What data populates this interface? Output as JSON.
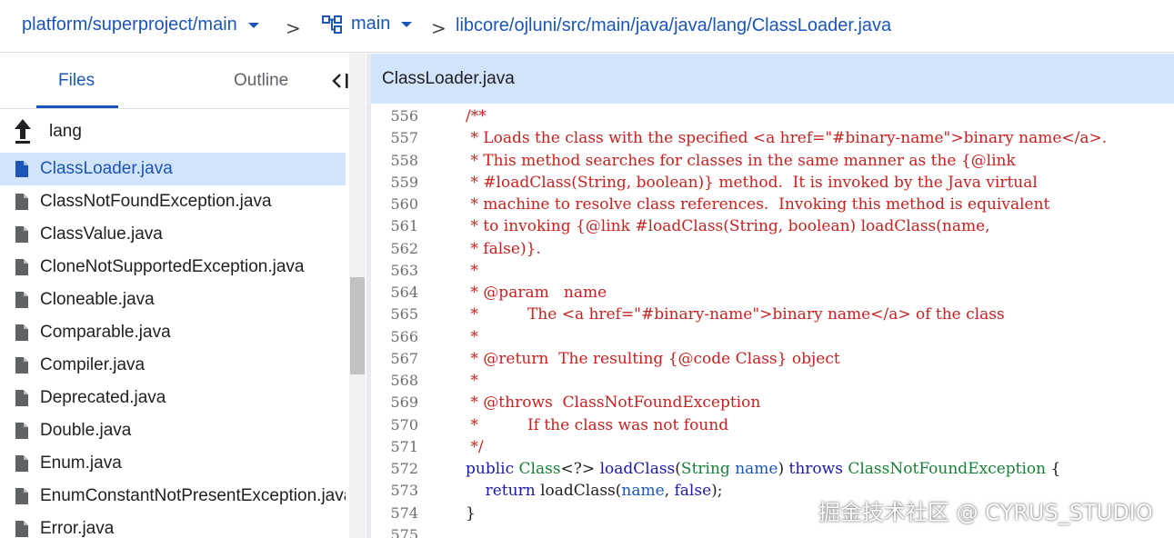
{
  "breadcrumb": {
    "project": "platform/superproject/main",
    "branch": "main",
    "path": "libcore/ojluni/src/main/java/java/lang/ClassLoader.java",
    "separator": ">"
  },
  "sidebar": {
    "tabs": [
      {
        "label": "Files",
        "active": true
      },
      {
        "label": "Outline",
        "active": false
      }
    ],
    "collapse_icon": "collapse-left-icon",
    "parent_dir": {
      "label": "lang",
      "icon": "up-arrow-icon"
    },
    "files": [
      {
        "name": "ClassLoader.java",
        "selected": true
      },
      {
        "name": "ClassNotFoundException.java",
        "selected": false
      },
      {
        "name": "ClassValue.java",
        "selected": false
      },
      {
        "name": "CloneNotSupportedException.java",
        "selected": false
      },
      {
        "name": "Cloneable.java",
        "selected": false
      },
      {
        "name": "Comparable.java",
        "selected": false
      },
      {
        "name": "Compiler.java",
        "selected": false
      },
      {
        "name": "Deprecated.java",
        "selected": false
      },
      {
        "name": "Double.java",
        "selected": false
      },
      {
        "name": "Enum.java",
        "selected": false
      },
      {
        "name": "EnumConstantNotPresentException.java",
        "selected": false
      },
      {
        "name": "Error.java",
        "selected": false
      }
    ]
  },
  "editor": {
    "file_title": "ClassLoader.java",
    "lines": [
      {
        "num": "556",
        "tokens": [
          {
            "t": "/**",
            "k": "comment"
          }
        ]
      },
      {
        "num": "557",
        "tokens": [
          {
            "t": " * Loads the class with the specified <a href=\"#binary-name\">binary name</a>.",
            "k": "comment"
          }
        ]
      },
      {
        "num": "558",
        "tokens": [
          {
            "t": " * This method searches for classes in the same manner as the {@link",
            "k": "comment"
          }
        ]
      },
      {
        "num": "559",
        "tokens": [
          {
            "t": " * #loadClass(String, boolean)} method.  It is invoked by the Java virtual",
            "k": "comment"
          }
        ]
      },
      {
        "num": "560",
        "tokens": [
          {
            "t": " * machine to resolve class references.  Invoking this method is equivalent",
            "k": "comment"
          }
        ]
      },
      {
        "num": "561",
        "tokens": [
          {
            "t": " * to invoking {@link #loadClass(String, boolean) loadClass(name,",
            "k": "comment"
          }
        ]
      },
      {
        "num": "562",
        "tokens": [
          {
            "t": " * false)}.",
            "k": "comment"
          }
        ]
      },
      {
        "num": "563",
        "tokens": [
          {
            "t": " *",
            "k": "comment"
          }
        ]
      },
      {
        "num": "564",
        "tokens": [
          {
            "t": " * @param   name",
            "k": "comment"
          }
        ]
      },
      {
        "num": "565",
        "tokens": [
          {
            "t": " *          The <a href=\"#binary-name\">binary name</a> of the class",
            "k": "comment"
          }
        ]
      },
      {
        "num": "566",
        "tokens": [
          {
            "t": " *",
            "k": "comment"
          }
        ]
      },
      {
        "num": "567",
        "tokens": [
          {
            "t": " * @return  The resulting {@code Class} object",
            "k": "comment"
          }
        ]
      },
      {
        "num": "568",
        "tokens": [
          {
            "t": " *",
            "k": "comment"
          }
        ]
      },
      {
        "num": "569",
        "tokens": [
          {
            "t": " * @throws  ClassNotFoundException",
            "k": "comment"
          }
        ]
      },
      {
        "num": "570",
        "tokens": [
          {
            "t": " *          If the class was not found",
            "k": "comment"
          }
        ]
      },
      {
        "num": "571",
        "tokens": [
          {
            "t": " */",
            "k": "comment"
          }
        ]
      },
      {
        "num": "572",
        "tokens": [
          {
            "t": "public ",
            "k": "kw"
          },
          {
            "t": "Class",
            "k": "type"
          },
          {
            "t": "<?> ",
            "k": "plain"
          },
          {
            "t": "loadClass",
            "k": "fn"
          },
          {
            "t": "(",
            "k": "plain"
          },
          {
            "t": "String",
            "k": "type"
          },
          {
            "t": " ",
            "k": "plain"
          },
          {
            "t": "name",
            "k": "var"
          },
          {
            "t": ") ",
            "k": "plain"
          },
          {
            "t": "throws ",
            "k": "kw"
          },
          {
            "t": "ClassNotFoundException",
            "k": "type"
          },
          {
            "t": " {",
            "k": "plain"
          }
        ]
      },
      {
        "num": "573",
        "tokens": [
          {
            "t": "    return ",
            "k": "kw"
          },
          {
            "t": "loadClass",
            "k": "plain"
          },
          {
            "t": "(",
            "k": "plain"
          },
          {
            "t": "name",
            "k": "var"
          },
          {
            "t": ", ",
            "k": "plain"
          },
          {
            "t": "false",
            "k": "kw"
          },
          {
            "t": ");",
            "k": "plain"
          }
        ]
      },
      {
        "num": "574",
        "tokens": [
          {
            "t": "}",
            "k": "plain"
          }
        ]
      },
      {
        "num": "575",
        "tokens": []
      }
    ]
  },
  "watermark": "掘金技术社区 @ CYRUS_STUDIO",
  "colors": {
    "accent": "#1a56b8",
    "selected_bg": "#d2e3fc",
    "comment": "#c5221f",
    "keyword": "#1a1aa6",
    "type": "#188038"
  }
}
